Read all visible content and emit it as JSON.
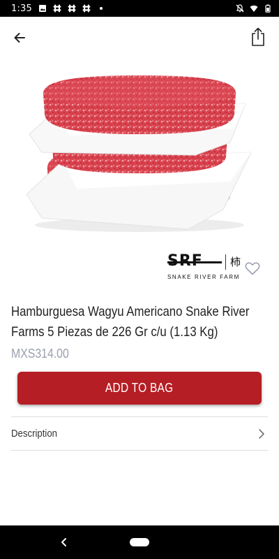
{
  "status_bar": {
    "time": "1:35",
    "notification_icons": [
      "image-icon",
      "slack-icon",
      "slack-icon",
      "slack-icon",
      "dot-icon"
    ],
    "system_icons": [
      "notifications-off-icon",
      "wifi-icon",
      "battery-icon"
    ]
  },
  "app_bar": {
    "back_icon": "arrow-left-icon",
    "share_icon": "share-icon"
  },
  "product": {
    "image_icon": "product-photo-burger-patties",
    "brand": {
      "mark": "SRF",
      "kanji": "柿",
      "name": "SNAKE RIVER FARMS"
    },
    "wishlist_icon": "heart-outline-icon",
    "title": "Hamburguesa Wagyu Americano Snake River Farms 5 Piezas de 226 Gr c/u (1.13 Kg)",
    "price": "MXS314.00"
  },
  "actions": {
    "add_to_bag_label": "ADD TO BAG"
  },
  "description": {
    "label": "Description"
  },
  "colors": {
    "accent": "#b51e24",
    "price": "#9aa0ac"
  }
}
